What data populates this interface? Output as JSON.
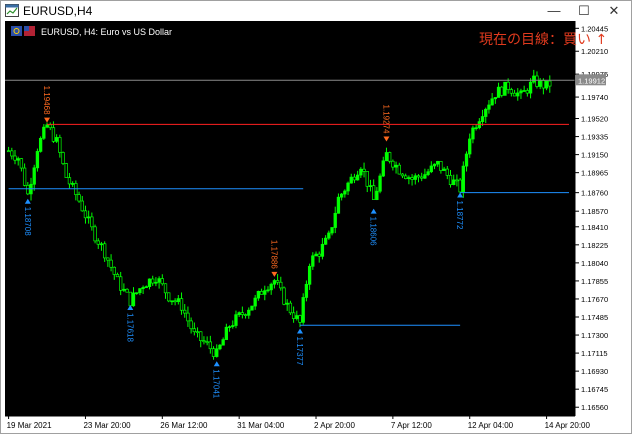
{
  "window": {
    "title": "EURUSD,H4",
    "minimize_glyph": "—",
    "maximize_glyph": "☐",
    "close_glyph": "✕"
  },
  "chart": {
    "caption": "EURUSD, H4:  Euro vs US Dollar",
    "note": "現在の目線：買い ↑",
    "current_price_label": "1.19912"
  },
  "colors": {
    "background": "#000000",
    "candle": "#00ff00",
    "resistance": "#ff2020",
    "support": "#1e90ff",
    "high_label": "#ff6a20",
    "low_label": "#1e90ff",
    "axis_text": "#ffffff",
    "current_price_line": "#8a8a8a"
  },
  "chart_data": {
    "type": "candlestick",
    "y_ticks": [
      "1.20445",
      "1.20210",
      "1.19975",
      "1.19740",
      "1.19520",
      "1.19335",
      "1.19150",
      "1.18965",
      "1.18760",
      "1.18570",
      "1.18410",
      "1.18225",
      "1.18040",
      "1.17855",
      "1.17670",
      "1.17485",
      "1.17300",
      "1.17115",
      "1.16930",
      "1.16745",
      "1.16560"
    ],
    "x_ticks": [
      "19 Mar 2021",
      "23 Mar 20:00",
      "26 Mar 12:00",
      "31 Mar 04:00",
      "2 Apr 20:00",
      "7 Apr 12:00",
      "12 Apr 04:00",
      "14 Apr 20:00"
    ],
    "ylim": [
      1.1647,
      1.2052
    ],
    "current_price": 1.19912,
    "swing_points": [
      {
        "label": "1.18708",
        "type": "low",
        "bar": 6,
        "price": 1.18708
      },
      {
        "label": "1.19468",
        "type": "high",
        "bar": 12,
        "price": 1.19468
      },
      {
        "label": "1.17618",
        "type": "low",
        "bar": 38,
        "price": 1.17618
      },
      {
        "label": "1.17041",
        "type": "low",
        "bar": 65,
        "price": 1.17041
      },
      {
        "label": "1.17886",
        "type": "high",
        "bar": 83,
        "price": 1.17886
      },
      {
        "label": "1.17377",
        "type": "low",
        "bar": 91,
        "price": 1.17377
      },
      {
        "label": "1.18606",
        "type": "low",
        "bar": 114,
        "price": 1.18606
      },
      {
        "label": "1.19274",
        "type": "high",
        "bar": 118,
        "price": 1.19274
      },
      {
        "label": "1.18772",
        "type": "low",
        "bar": 141,
        "price": 1.18772
      }
    ],
    "levels": [
      {
        "type": "resistance",
        "price": 1.1946,
        "from_bar": 12,
        "to_bar": 175
      },
      {
        "type": "support",
        "price": 1.188,
        "from_bar": 0,
        "to_bar": 92
      },
      {
        "type": "support",
        "price": 1.174,
        "from_bar": 91,
        "to_bar": 141
      },
      {
        "type": "support",
        "price": 1.1876,
        "from_bar": 141,
        "to_bar": 175
      }
    ],
    "bar_count": 170,
    "path_points": [
      [
        0,
        1.1919
      ],
      [
        3,
        1.1912
      ],
      [
        6,
        1.1874
      ],
      [
        9,
        1.1922
      ],
      [
        12,
        1.1945
      ],
      [
        15,
        1.1928
      ],
      [
        18,
        1.1892
      ],
      [
        22,
        1.1868
      ],
      [
        26,
        1.1838
      ],
      [
        30,
        1.1815
      ],
      [
        34,
        1.1785
      ],
      [
        38,
        1.1765
      ],
      [
        42,
        1.1782
      ],
      [
        46,
        1.179
      ],
      [
        50,
        1.177
      ],
      [
        54,
        1.176
      ],
      [
        58,
        1.173
      ],
      [
        62,
        1.172
      ],
      [
        65,
        1.171
      ],
      [
        69,
        1.174
      ],
      [
        73,
        1.1752
      ],
      [
        77,
        1.1765
      ],
      [
        80,
        1.178
      ],
      [
        83,
        1.1786
      ],
      [
        87,
        1.176
      ],
      [
        91,
        1.1742
      ],
      [
        94,
        1.1805
      ],
      [
        97,
        1.1815
      ],
      [
        100,
        1.183
      ],
      [
        103,
        1.187
      ],
      [
        106,
        1.1885
      ],
      [
        110,
        1.1905
      ],
      [
        114,
        1.1868
      ],
      [
        118,
        1.1915
      ],
      [
        122,
        1.19
      ],
      [
        126,
        1.189
      ],
      [
        130,
        1.1895
      ],
      [
        134,
        1.1905
      ],
      [
        138,
        1.189
      ],
      [
        141,
        1.188
      ],
      [
        144,
        1.1935
      ],
      [
        148,
        1.196
      ],
      [
        152,
        1.1978
      ],
      [
        156,
        1.1985
      ],
      [
        160,
        1.1975
      ],
      [
        164,
        1.199
      ],
      [
        168,
        1.1985
      ],
      [
        170,
        1.199
      ]
    ]
  }
}
